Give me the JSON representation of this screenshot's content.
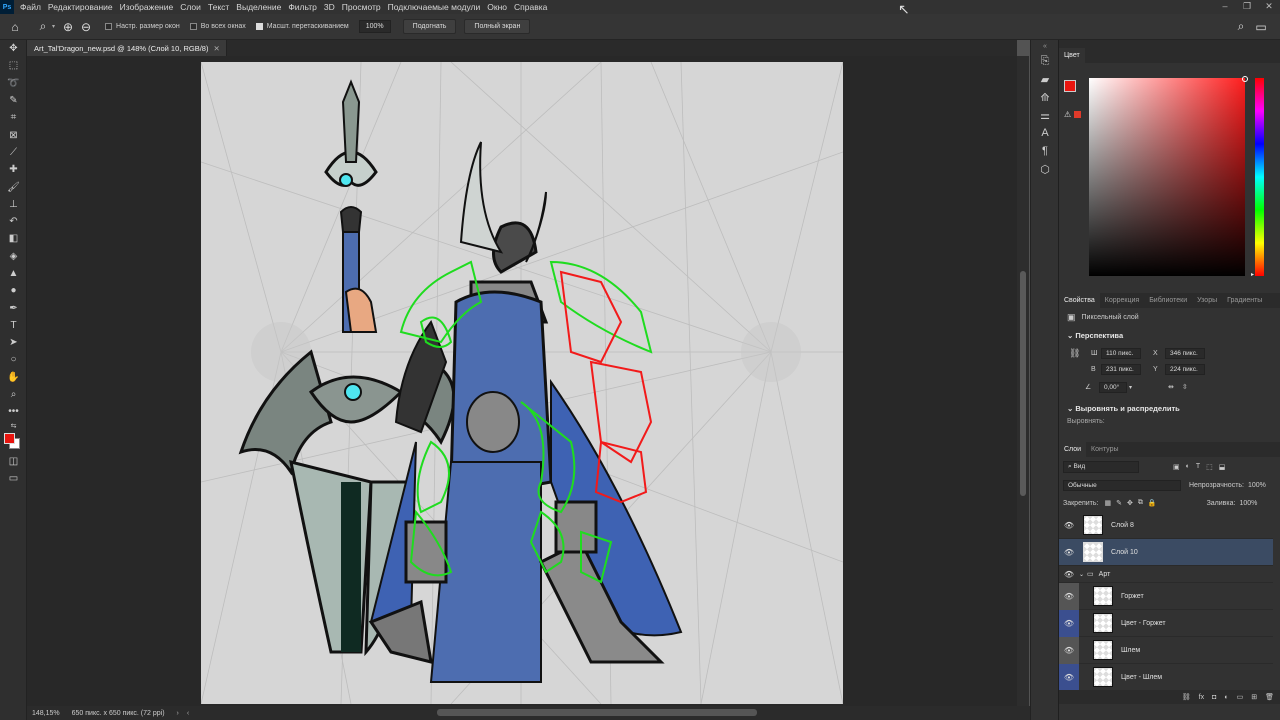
{
  "menu": [
    "Файл",
    "Редактирование",
    "Изображение",
    "Слои",
    "Текст",
    "Выделение",
    "Фильтр",
    "3D",
    "Просмотр",
    "Подключаемые модули",
    "Окно",
    "Справка"
  ],
  "options": {
    "resize_windows": "Настр. размер окон",
    "all_windows": "Во всех окнах",
    "scrubby_zoom": "Масшт. перетаскиванием",
    "zoom_value": "100%",
    "fit_button": "Подогнать",
    "fullscreen_button": "Полный экран"
  },
  "document": {
    "tab_title": "Art_Tal'Dragon_new.psd @ 148% (Слой 10, RGB/8)",
    "zoom_status": "148,15%",
    "size_status": "650 пикс. x 650 пикс. (72 ppi)"
  },
  "color_panel": {
    "title": "Цвет",
    "foreground": "#e8150f",
    "hue_color": "#ff1e1e"
  },
  "properties": {
    "tabs": [
      "Свойства",
      "Коррекция",
      "Библиотеки",
      "Узоры",
      "Градиенты"
    ],
    "layer_type": "Пиксельный слой",
    "perspective_title": "Перспектива",
    "w_label": "Ш",
    "w_value": "110 пикс.",
    "h_label": "В",
    "h_value": "231 пикс.",
    "x_label": "X",
    "x_value": "346 пикс.",
    "y_label": "Y",
    "y_value": "224 пикс.",
    "angle_value": "0,00°",
    "align_title": "Выровнять и распределить",
    "align_label": "Выровнять:"
  },
  "layers": {
    "tabs": [
      "Слои",
      "Контуры"
    ],
    "filter_kind": "Вид",
    "blend_mode": "Обычные",
    "opacity_label": "Непрозрачность:",
    "opacity_value": "100%",
    "lock_label": "Закрепить:",
    "fill_label": "Заливка:",
    "fill_value": "100%",
    "items": [
      {
        "name": "Слой 8"
      },
      {
        "name": "Слой 10"
      },
      {
        "name": "Арт"
      },
      {
        "name": "Горжет"
      },
      {
        "name": "Цвет - Горжет"
      },
      {
        "name": "Шлем"
      },
      {
        "name": "Цвет - Шлем"
      }
    ]
  }
}
